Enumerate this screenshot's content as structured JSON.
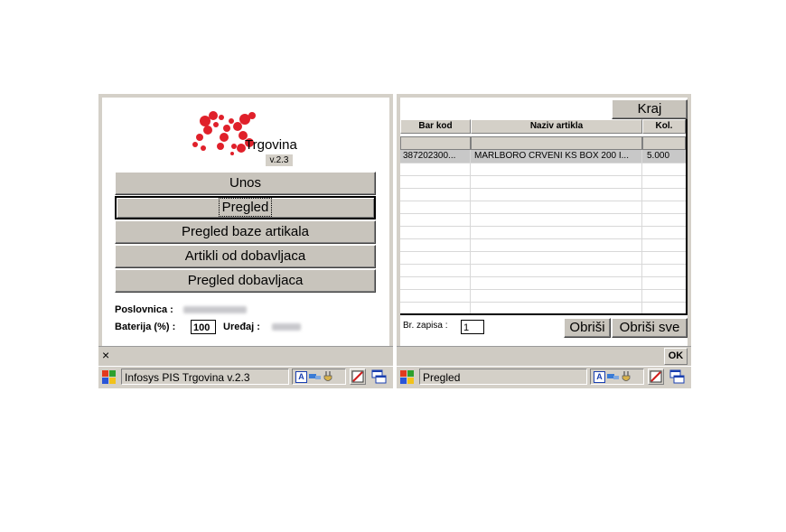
{
  "left": {
    "logo_text": "Trgovina",
    "version": "v.2.3",
    "menu": [
      "Unos",
      "Pregled",
      "Pregled baze artikala",
      "Artikli od dobavljaca",
      "Pregled dobavljaca"
    ],
    "poslovnica_label": "Poslovnica :",
    "baterija_label": "Baterija (%) :",
    "baterija_value": "100",
    "uredaj_label": "Uređaj :",
    "close_symbol": "×",
    "taskbar_title": "Infosys PIS Trgovina v.2.3"
  },
  "right": {
    "kraj_label": "Kraj",
    "columns": [
      "Bar kod",
      "Naziv artikla",
      "Kol."
    ],
    "rows": [
      {
        "bar_kod": "387202300...",
        "naziv": "MARLBORO CRVENI KS BOX 200 I...",
        "kol": "5.000"
      }
    ],
    "br_zapisa_label": "Br. zapisa :",
    "br_zapisa_value": "1",
    "obrisi_label": "Obriši",
    "obrisi_sve_label": "Obriši sve",
    "ok_label": "OK",
    "taskbar_title": "Pregled"
  },
  "tray": {
    "input_indicator": "A",
    "icons": [
      "network-icon",
      "power-icon",
      "keyboard-icon",
      "windows-icon"
    ]
  },
  "colors": {
    "logo_red": "#e0202a",
    "device_frame": "#d4d0c8"
  }
}
